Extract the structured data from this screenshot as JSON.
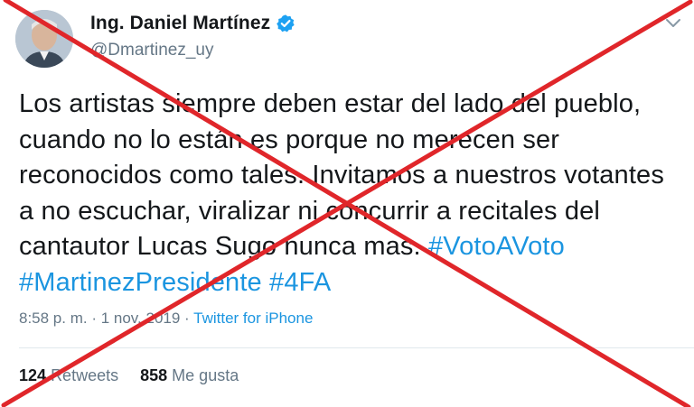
{
  "author": {
    "display_name": "Ing. Daniel Martínez",
    "handle": "@Dmartinez_uy",
    "verified": true
  },
  "tweet": {
    "text_plain": "Los artistas siempre deben estar del lado del pueblo, cuando no lo están es porque no merecen ser reconocidos como tales. Invitamos a nuestros votantes a no escuchar, viralizar ni concurrir a recitales del cantautor Lucas Sugo nunca mas.",
    "hashtags": [
      "#VotoAVoto",
      "#MartinezPresidente",
      "#4FA"
    ]
  },
  "meta": {
    "time": "8:58 p. m.",
    "separator1": " · ",
    "date": "1 nov. 2019",
    "separator2": " · ",
    "source": "Twitter for iPhone"
  },
  "stats": {
    "retweets_count": "124",
    "retweets_label": "Retweets",
    "likes_count": "858",
    "likes_label": "Me gusta"
  },
  "icons": {
    "verified": "verified-badge-icon",
    "menu": "chevron-down-icon",
    "overlay": "red-x-overlay"
  },
  "colors": {
    "link": "#1b95e0",
    "secondary_text": "#657786",
    "verified": "#1da1f2",
    "overlay_x": "#e0262a"
  }
}
